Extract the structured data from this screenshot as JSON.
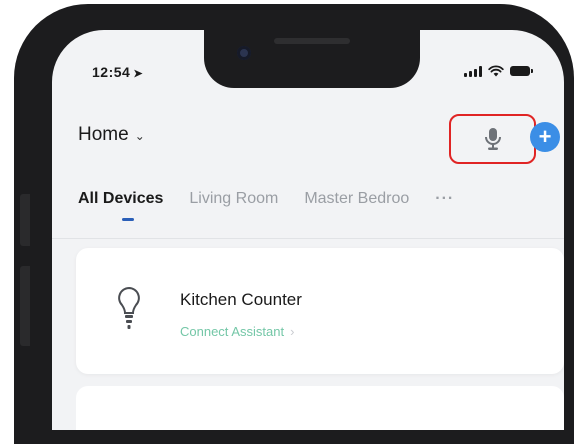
{
  "status_bar": {
    "time": "12:54",
    "location_arrow": "➤"
  },
  "header": {
    "home_label": "Home",
    "home_chevron": "⌄",
    "add_symbol": "+"
  },
  "tabs": [
    {
      "label": "All Devices",
      "active": true
    },
    {
      "label": "Living Room",
      "active": false
    },
    {
      "label": "Master Bedroo",
      "active": false
    }
  ],
  "tabs_more": "···",
  "device": {
    "name": "Kitchen Counter",
    "status": "Connect Assistant",
    "status_chevron": "›"
  },
  "colors": {
    "accent_blue": "#3b8ee6",
    "highlight_red": "#e02424",
    "status_green": "#74c7a7"
  },
  "icons": [
    "microphone-icon",
    "add-icon",
    "bulb-icon",
    "signal-icon",
    "wifi-icon",
    "battery-icon"
  ]
}
